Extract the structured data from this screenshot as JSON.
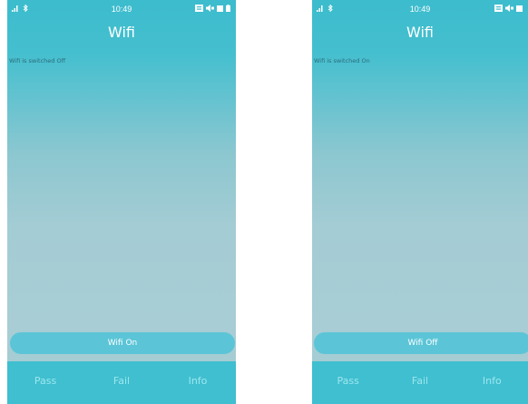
{
  "colors": {
    "accent": "#3cbccd",
    "button": "#5bc5d7",
    "bottom_bar": "#3fbfcf",
    "status_text": "#2d6b78",
    "bottom_text": "#9ee6ef"
  },
  "screens": [
    {
      "status_bar": {
        "time": "10:49",
        "icons": [
          "signal-icon",
          "bluetooth-icon",
          "sim-icon",
          "volume-icon",
          "square-icon",
          "battery-icon"
        ]
      },
      "title": "Wifi",
      "status_message": "Wifi is switched Off",
      "toggle_button": "Wifi On",
      "bottom_bar": {
        "pass": "Pass",
        "fail": "Fail",
        "info": "Info"
      }
    },
    {
      "status_bar": {
        "time": "10:49",
        "icons": [
          "signal-icon",
          "bluetooth-icon",
          "sim-icon",
          "volume-icon",
          "square-icon"
        ]
      },
      "title": "Wifi",
      "status_message": "Wifi is switched On",
      "toggle_button": "Wifi Off",
      "bottom_bar": {
        "pass": "Pass",
        "fail": "Fail",
        "info": "Info"
      }
    }
  ]
}
